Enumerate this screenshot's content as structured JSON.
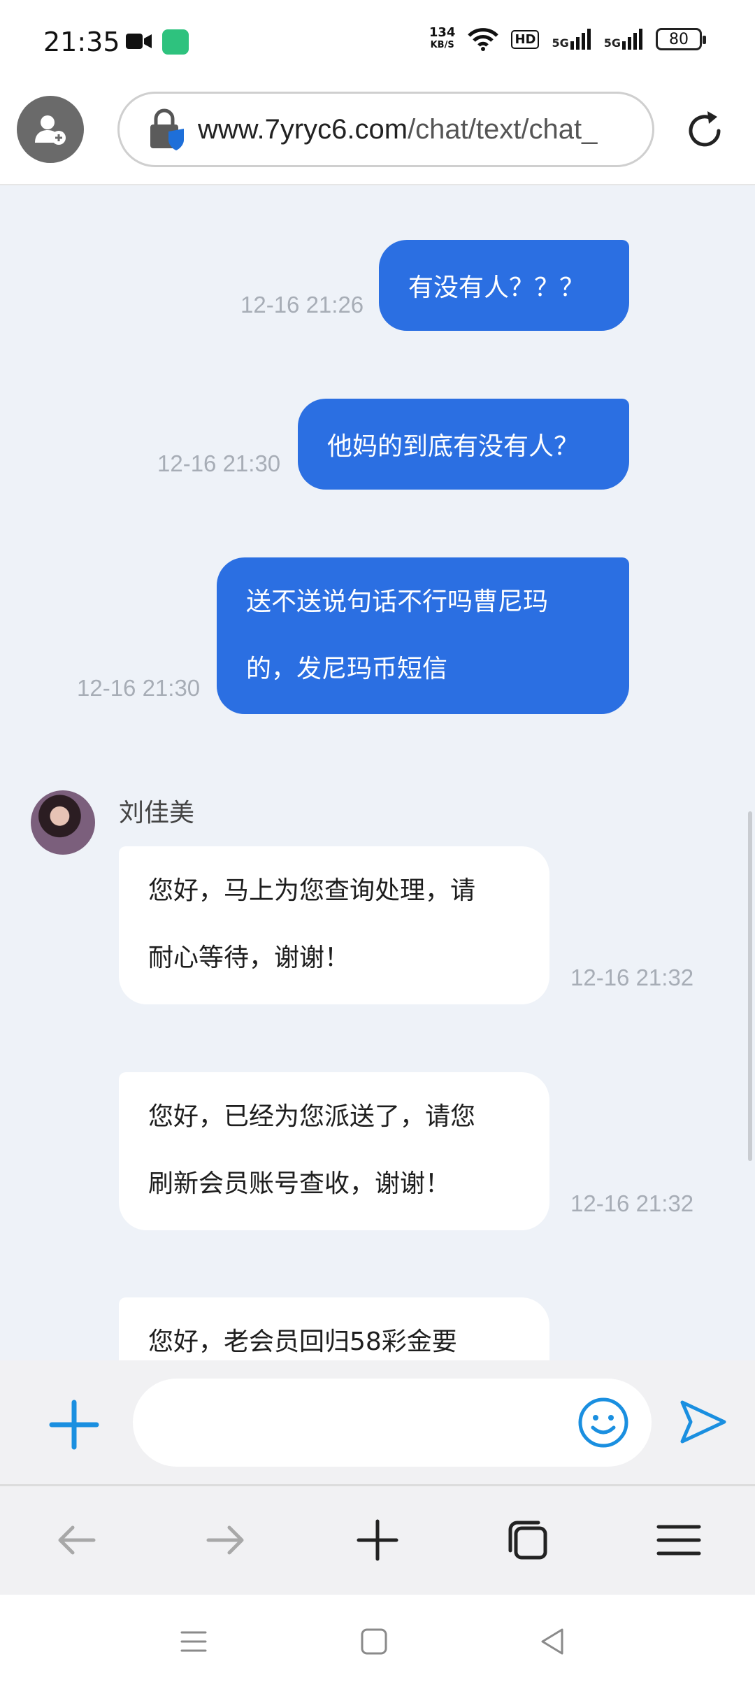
{
  "status_bar": {
    "time": "21:35",
    "net_speed_value": "134",
    "net_speed_unit": "KB/S",
    "hd_label": "HD",
    "signal1_label": "5G",
    "signal2_label": "5G",
    "battery": "80"
  },
  "address_bar": {
    "url_host": "www.7yryc6.com",
    "url_path": "/chat/text/chat_"
  },
  "chat": {
    "outgoing": [
      {
        "text": "有没有人？？？",
        "time": "12-16 21:26"
      },
      {
        "text": "他妈的到底有没有人？",
        "time": "12-16 21:30"
      },
      {
        "line1": "送不送说句话不行吗曹尼玛",
        "line2": "的，发尼玛币短信",
        "time": "12-16 21:30"
      }
    ],
    "agent_name": "刘佳美",
    "incoming": [
      {
        "line1": "您好，马上为您查询处理，请",
        "line2": "耐心等待，谢谢！",
        "time": "12-16 21:32"
      },
      {
        "line1": "您好，已经为您派送了，请您",
        "line2": "刷新会员账号查收，谢谢！",
        "time": "12-16 21:32"
      },
      {
        "line1": "您好，老会员回归58彩金要"
      }
    ]
  },
  "input": {
    "placeholder": ""
  },
  "colors": {
    "outgoing_bubble": "#2b6fe2",
    "chat_background": "#eef2f8",
    "accent_icon": "#1a8fe0"
  }
}
